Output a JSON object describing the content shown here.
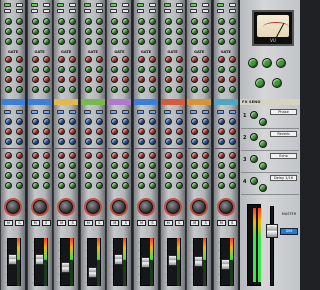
{
  "labels": {
    "gate": "GATE",
    "comp": "COMP",
    "eq": "EQ",
    "mute": "M",
    "solo": "S",
    "pan": "PAN"
  },
  "fx": {
    "header": "FX SEND",
    "slots": [
      {
        "num": "1",
        "name": "Phase"
      },
      {
        "num": "2",
        "name": "Reverb"
      },
      {
        "num": "3",
        "name": "Echo"
      },
      {
        "num": "4",
        "name": "Delay 1/16"
      }
    ]
  },
  "master": {
    "vu_label": "VU",
    "label": "MASTER",
    "box": "DIM",
    "left_label": "STEREO",
    "right_label": "INPUT"
  },
  "band_colors": [
    "#3b7fd9",
    "#3b7fd9",
    "#e1b84e",
    "#79b84a",
    "#b07acc",
    "#3b7fd9",
    "#d85a3c",
    "#d59536",
    "#4da6c2"
  ],
  "channel_levels": [
    0.58,
    0.58,
    0.36,
    0.22,
    0.57,
    0.49,
    0.55,
    0.52,
    0.44
  ],
  "colors": {
    "knob_green": "#3f9c35",
    "knob_red": "#c8392c",
    "knob_blue": "#2f62b8"
  }
}
